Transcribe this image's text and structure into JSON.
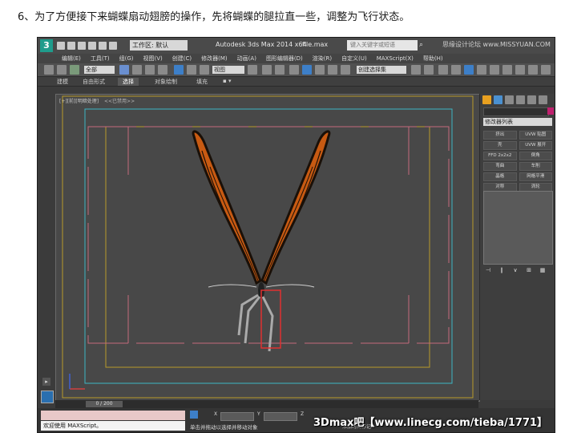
{
  "caption": "6、为了方便接下来蝴蝶扇动翅膀的操作，先将蝴蝶的腿拉直一些，调整为飞行状态。",
  "titlebar": {
    "logo_text": "3",
    "workspace": "工作区: 默认",
    "app_title": "Autodesk 3ds Max  2014 x64",
    "file_name": "file.max",
    "search_placeholder": "键入关键字或短语",
    "watermark": "思缘设计论坛 www.MISSYUAN.COM"
  },
  "menu": [
    "编辑(E)",
    "工具(T)",
    "组(G)",
    "视图(V)",
    "创建(C)",
    "修改器(M)",
    "动画(A)",
    "图形编辑器(D)",
    "渲染(R)",
    "自定义(U)",
    "MAXScript(X)",
    "帮助(H)"
  ],
  "toolbar": {
    "filter": "全部",
    "view": "视图",
    "selection_set": "创建选择集"
  },
  "ribbon": {
    "tabs": [
      "建模",
      "自由形式",
      "选择",
      "对象绘制",
      "填充"
    ],
    "active_index": 2
  },
  "viewport": {
    "label": "[+][前][明暗处理]",
    "label2": "<<已禁用>>"
  },
  "command_panel": {
    "modifier_list": "修改器列表",
    "modifiers": [
      "挤出",
      "UVW 贴图",
      "壳",
      "UVW 展开",
      "FFD 2x2x2",
      "倒角",
      "弯曲",
      "车削",
      "晶格",
      "网格平滑",
      "对称",
      "涡轮"
    ]
  },
  "timeline": {
    "slider": "0 / 200"
  },
  "status": {
    "maxscript": "欢迎使用 MAXScript。",
    "prompt": "单击并拖动以选择并移动对象",
    "coord_x": "X",
    "coord_y": "Y",
    "coord_z": "Z",
    "extra": "添加时间标记"
  },
  "overlay": {
    "watermark": "3Dmax吧【www.linecg.com/tieba/1771】"
  },
  "colors": {
    "app_bg": "#3b3b3b",
    "viewport_bg": "#484848",
    "safe_frame_yellow": "#b79a2a",
    "safe_frame_cyan": "#3bb6c4",
    "safe_frame_pink": "#c46a7c",
    "wing_orange": "#c85a12",
    "selection_red": "#e03030"
  }
}
